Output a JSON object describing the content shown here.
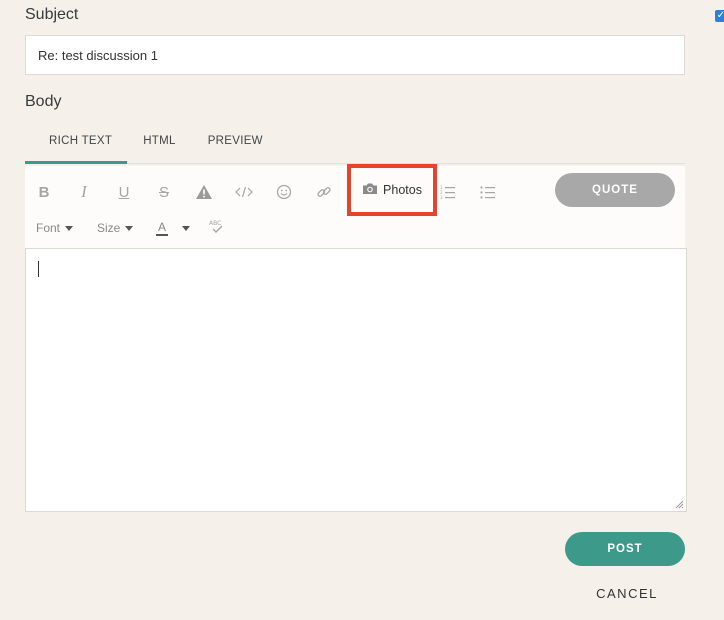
{
  "form": {
    "subject_label": "Subject",
    "subject_value": "Re: test discussion 1",
    "body_label": "Body"
  },
  "tabs": [
    {
      "label": "RICH TEXT",
      "active": true
    },
    {
      "label": "HTML",
      "active": false
    },
    {
      "label": "PREVIEW",
      "active": false
    }
  ],
  "toolbar": {
    "bold": "B",
    "italic": "I",
    "underline": "U",
    "strike": "S",
    "photos_label": "Photos",
    "quote_label": "QUOTE",
    "font_label": "Font",
    "size_label": "Size",
    "color_label": "A",
    "spell_label": "ABC",
    "icons": [
      "bold-icon",
      "italic-icon",
      "underline-icon",
      "strikethrough-icon",
      "warning-icon",
      "code-icon",
      "emoji-icon",
      "link-icon",
      "camera-icon",
      "ordered-list-icon",
      "unordered-list-icon",
      "spellcheck-icon"
    ]
  },
  "actions": {
    "post_label": "POST",
    "cancel_label": "CANCEL"
  },
  "colors": {
    "accent": "#3d9a8b",
    "highlight_box": "#e4442c",
    "quote_button": "#a8a8a8",
    "checkbox": "#2f7fd6"
  }
}
